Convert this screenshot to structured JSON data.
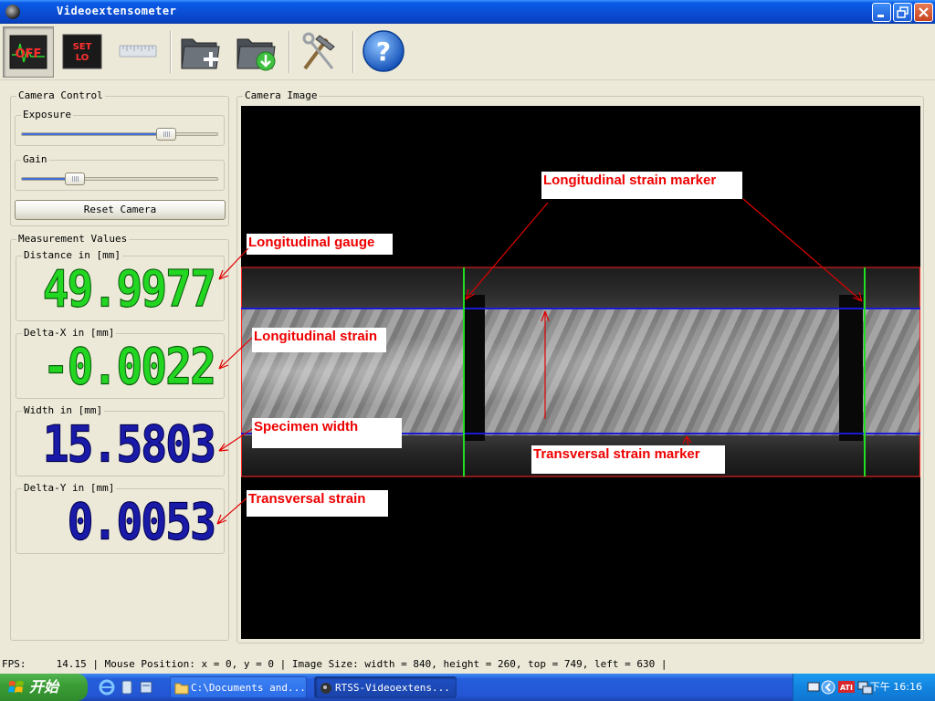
{
  "window": {
    "title": "Videoextensometer"
  },
  "toolbar": {
    "off_label": "OFF",
    "set_lo_line1": "SET",
    "set_lo_line2": "LO"
  },
  "camera_control": {
    "title": "Camera Control",
    "exposure_label": "Exposure",
    "exposure_level": 0.74,
    "gain_label": "Gain",
    "gain_level": 0.27,
    "reset_label": "Reset Camera"
  },
  "measurements": {
    "title": "Measurement Values",
    "distance_label": "Distance in [mm]",
    "distance_value": "49.9977",
    "delta_x_label": "Delta-X in [mm]",
    "delta_x_value": "-0.0022",
    "width_label": "Width in [mm]",
    "width_value": "15.5803",
    "delta_y_label": "Delta-Y in [mm]",
    "delta_y_value": "0.0053"
  },
  "camera_image": {
    "title": "Camera Image",
    "annotations": {
      "longitudinal_strain_marker": "Longitudinal  strain marker",
      "longitudinal_gauge": "Longitudinal gauge",
      "longitudinal_strain": "Longitudinal strain",
      "specimen_width": "Specimen width",
      "transversal_strain_marker": "Transversal strain marker",
      "transversal_strain": "Transversal strain"
    }
  },
  "statusbar": {
    "text": "FPS:     14.15 | Mouse Position: x = 0, y = 0 | Image Size: width = 840, height = 260, top = 749, left = 630 |"
  },
  "taskbar": {
    "start_label": "开始",
    "task1_label": "C:\\Documents and...",
    "task2_label": "RTSS-Videoextens...",
    "clock": "下午 16:16"
  },
  "colors": {
    "annotation_red": "#e00000",
    "marker_green": "#22dd22",
    "marker_blue": "#1a1ad0",
    "gauge_red": "#ff2020"
  }
}
